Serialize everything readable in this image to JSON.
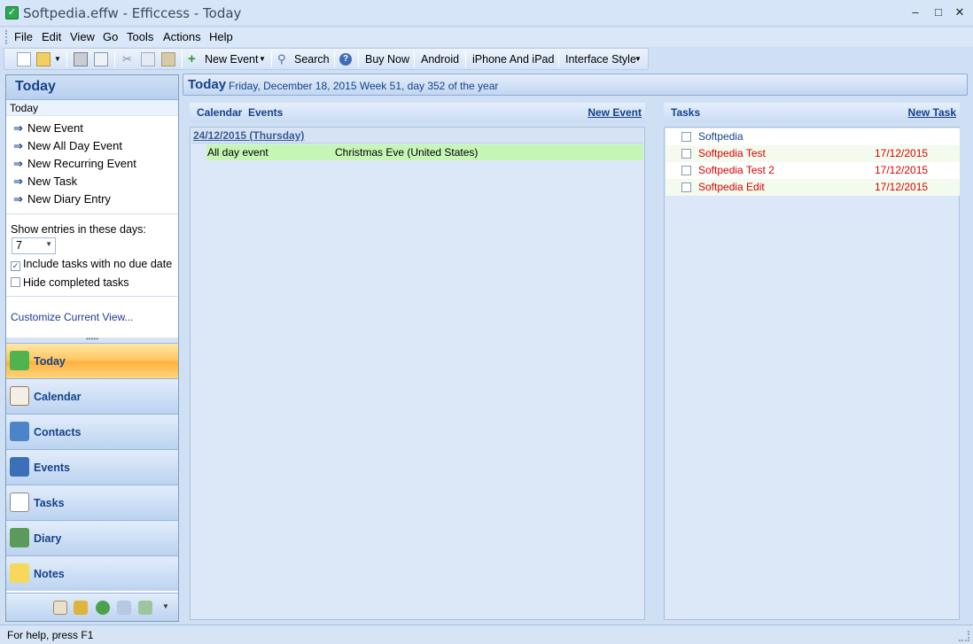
{
  "window": {
    "title": "Softpedia.effw - Efficcess - Today",
    "minimize": "–",
    "maximize": "□",
    "close": "✕"
  },
  "menu": {
    "file": "File",
    "edit": "Edit",
    "view": "View",
    "go": "Go",
    "tools": "Tools",
    "actions": "Actions",
    "help": "Help"
  },
  "toolbar": {
    "new_event": "New Event",
    "search": "Search",
    "buy_now": "Buy Now",
    "android": "Android",
    "iphone": "iPhone And iPad",
    "interface_style": "Interface Style"
  },
  "left": {
    "header": "Today",
    "sub": "Today",
    "actions": [
      "New Event",
      "New All Day Event",
      "New Recurring Event",
      "New Task",
      "New Diary Entry"
    ],
    "show_entries_label": "Show entries in these days:",
    "days_value": "7",
    "include_tasks": "Include tasks with no due date",
    "hide_completed": "Hide completed tasks",
    "customize": "Customize Current View...",
    "nav": [
      "Today",
      "Calendar",
      "Contacts",
      "Events",
      "Tasks",
      "Diary",
      "Notes"
    ]
  },
  "todaybar": {
    "title": "Today",
    "date": "Friday, December 18, 2015   Week 51, day 352 of the year"
  },
  "calendar": {
    "header_a": "Calendar",
    "header_b": "Events",
    "new_event_link": "New Event",
    "group_date": "24/12/2015 (Thursday)",
    "event_type": "All day event",
    "event_title": "Christmas Eve (United States)"
  },
  "tasks": {
    "header": "Tasks",
    "new_task_link": "New Task",
    "items": [
      {
        "name": "Softpedia",
        "date": ""
      },
      {
        "name": "Softpedia Test",
        "date": "17/12/2015"
      },
      {
        "name": "Softpedia Test 2",
        "date": "17/12/2015"
      },
      {
        "name": "Softpedia Edit",
        "date": "17/12/2015"
      }
    ]
  },
  "status": {
    "text": "For help, press F1"
  },
  "colors": {
    "accent": "#15428b",
    "overdue": "#e00000",
    "nav_active": "#ffc35a",
    "event_bg": "#c6f6b6"
  },
  "icons": {
    "app": "checkmark-icon",
    "new": "new-document-icon",
    "open": "open-folder-icon",
    "print": "print-icon",
    "print_preview": "print-preview-icon",
    "cut": "cut-icon",
    "copy": "copy-icon",
    "paste": "paste-icon",
    "add": "plus-icon",
    "search": "magnifier-icon",
    "help": "help-icon"
  }
}
